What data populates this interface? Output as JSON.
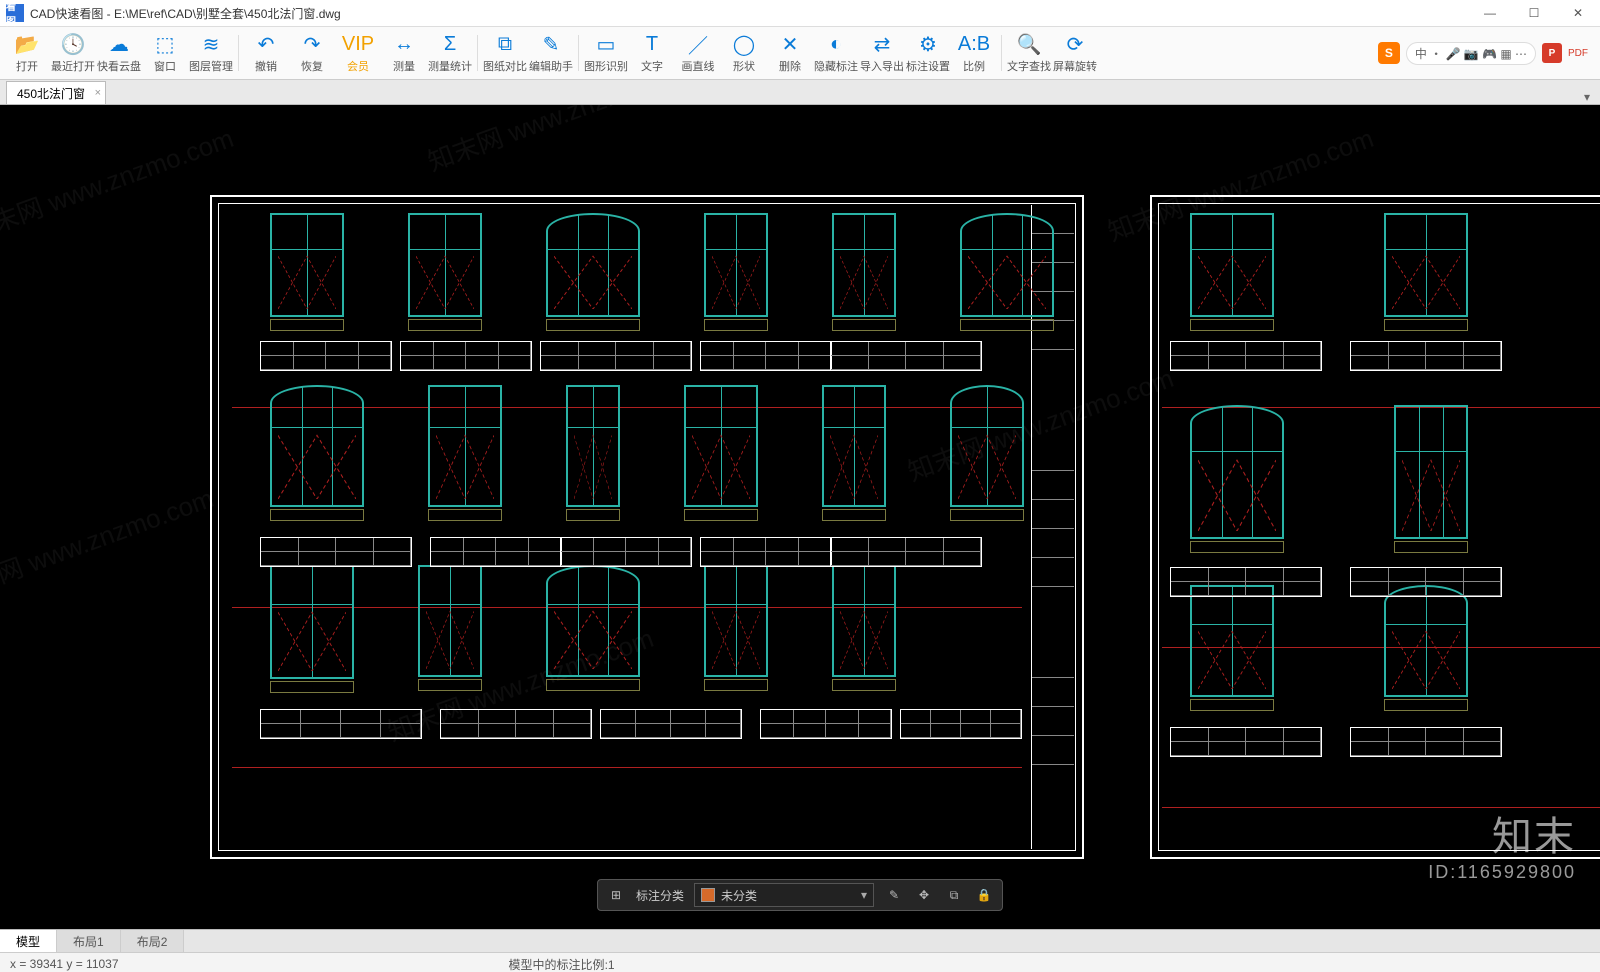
{
  "window": {
    "title": "CAD快速看图 - E:\\ME\\ref\\CAD\\别墅全套\\450北法门窗.dwg",
    "app_badge": "看图"
  },
  "toolbar": {
    "items": [
      {
        "icon": "📂",
        "label": "打开"
      },
      {
        "icon": "🕓",
        "label": "最近打开"
      },
      {
        "icon": "☁",
        "label": "快看云盘"
      },
      {
        "icon": "⬚",
        "label": "窗口"
      },
      {
        "icon": "≋",
        "label": "图层管理"
      },
      {
        "sep": true
      },
      {
        "icon": "↶",
        "label": "撤销"
      },
      {
        "icon": "↷",
        "label": "恢复"
      },
      {
        "icon": "VIP",
        "label": "会员",
        "vip": true
      },
      {
        "icon": "↔",
        "label": "测量"
      },
      {
        "icon": "Σ",
        "label": "测量统计"
      },
      {
        "sep": true
      },
      {
        "icon": "⧉",
        "label": "图纸对比"
      },
      {
        "icon": "✎",
        "label": "编辑助手"
      },
      {
        "sep": true
      },
      {
        "icon": "▭",
        "label": "图形识别"
      },
      {
        "icon": "T",
        "label": "文字"
      },
      {
        "icon": "／",
        "label": "画直线"
      },
      {
        "icon": "◯",
        "label": "形状"
      },
      {
        "icon": "✕",
        "label": "删除"
      },
      {
        "icon": "◐",
        "label": "隐藏标注"
      },
      {
        "icon": "⇄",
        "label": "导入导出"
      },
      {
        "icon": "⚙",
        "label": "标注设置"
      },
      {
        "icon": "A:B",
        "label": "比例"
      },
      {
        "sep": true
      },
      {
        "icon": "🔍",
        "label": "文字查找"
      },
      {
        "icon": "⟳",
        "label": "屏幕旋转"
      }
    ]
  },
  "tray": {
    "s": "S",
    "chip": "中 ・ 🎤 📷 🎮 ▦ ⋯",
    "p": "P",
    "pdf": "PDF"
  },
  "doc_tab": {
    "label": "450北法门窗"
  },
  "bottom_tabs": [
    "模型",
    "布局1",
    "布局2"
  ],
  "status": {
    "coords": "x = 39341  y = 11037",
    "scale_label": "模型中的标注比例",
    "scale_value": ":1"
  },
  "floatbar": {
    "category_label": "标注分类",
    "select_value": "未分类"
  },
  "watermark": "知末网 www.znzmo.com",
  "brand": {
    "line1": "知末",
    "line2": "ID:1165929800"
  }
}
